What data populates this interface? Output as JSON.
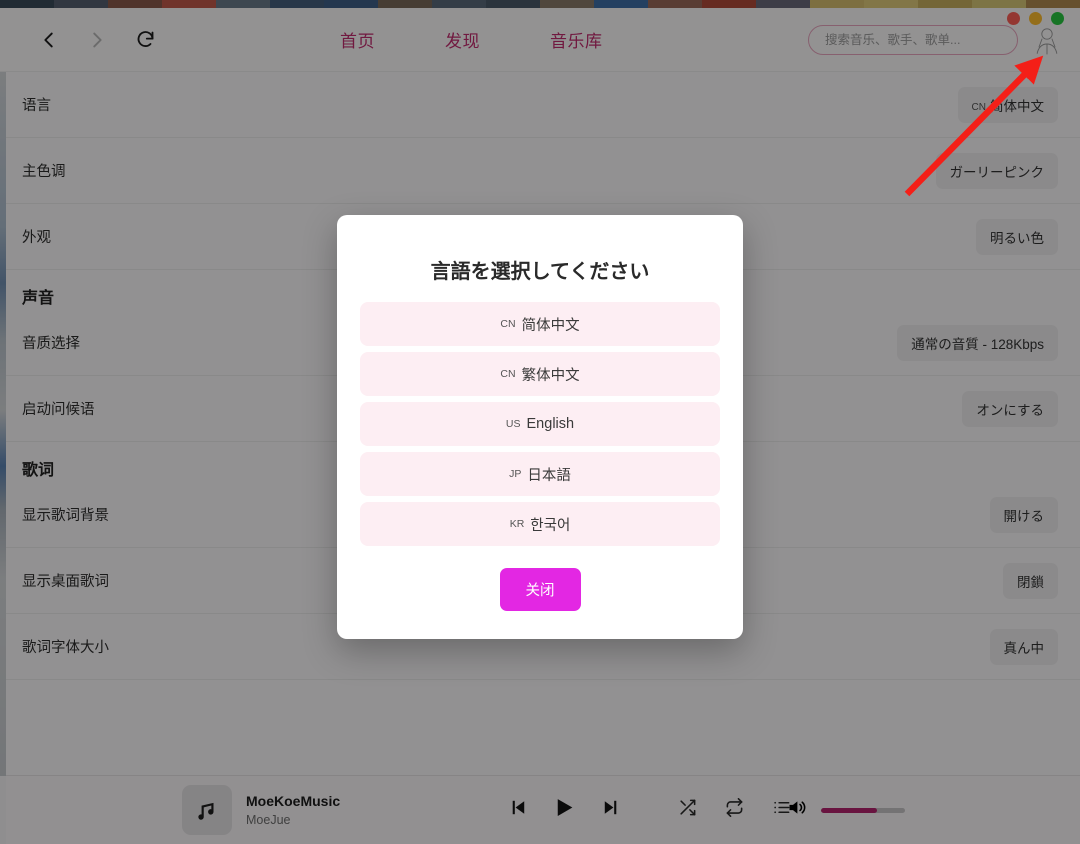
{
  "window": {
    "controls": [
      {
        "name": "close",
        "color": "#ff6057"
      },
      {
        "name": "minimize",
        "color": "#ffbd2e"
      },
      {
        "name": "maximize",
        "color": "#28c840"
      }
    ]
  },
  "nav": {
    "back_icon": "chevron-left-icon",
    "forward_icon": "chevron-right-icon",
    "refresh_icon": "refresh-icon",
    "links": [
      {
        "label": "首页"
      },
      {
        "label": "发现"
      },
      {
        "label": "音乐库"
      }
    ],
    "link_color": "#c32b6e",
    "search": {
      "placeholder": "搜索音乐、歌手、歌单...",
      "value": ""
    },
    "avatar_label": "avatar"
  },
  "settings": {
    "rows": [
      {
        "label": "语言",
        "value": "简体中文",
        "code": "CN"
      },
      {
        "label": "主色调",
        "value": "ガーリーピンク",
        "code": ""
      },
      {
        "label": "外观",
        "value": "明るい色",
        "code": ""
      }
    ],
    "sound_section": {
      "title": "声音",
      "rows": [
        {
          "label": "音质选择",
          "value": "通常の音質 - 128Kbps",
          "code": ""
        },
        {
          "label": "启动问候语",
          "value": "オンにする",
          "code": ""
        }
      ]
    },
    "lyrics_section": {
      "title": "歌词",
      "rows": [
        {
          "label": "显示歌词背景",
          "value": "開ける",
          "code": ""
        },
        {
          "label": "显示桌面歌词",
          "value": "閉鎖",
          "code": ""
        },
        {
          "label": "歌词字体大小",
          "value": "真ん中",
          "code": ""
        }
      ]
    }
  },
  "modal": {
    "title": "言語を選択してください",
    "languages": [
      {
        "code": "CN",
        "label": "简体中文"
      },
      {
        "code": "CN",
        "label": "繁体中文"
      },
      {
        "code": "US",
        "label": "English"
      },
      {
        "code": "JP",
        "label": "日本語"
      },
      {
        "code": "KR",
        "label": "한국어"
      }
    ],
    "close_label": "关闭",
    "close_color": "#e327e3",
    "item_bg": "#fdeef3"
  },
  "player": {
    "track_title": "MoeKoeMusic",
    "track_artist": "MoeJue",
    "cover_icon": "music-note-icon",
    "transport": [
      {
        "name": "previous-track",
        "icon": "skip-back-icon"
      },
      {
        "name": "play",
        "icon": "play-icon"
      },
      {
        "name": "next-track",
        "icon": "skip-forward-icon"
      }
    ],
    "tools": [
      {
        "name": "shuffle",
        "icon": "shuffle-icon"
      },
      {
        "name": "repeat",
        "icon": "repeat-icon"
      },
      {
        "name": "playlist",
        "icon": "list-icon"
      }
    ],
    "volume": {
      "icon": "volume-icon",
      "percent": 67,
      "fill_color": "#b5246f"
    }
  },
  "annotation": {
    "arrow_color": "#f41f18",
    "points_to": "avatar"
  }
}
